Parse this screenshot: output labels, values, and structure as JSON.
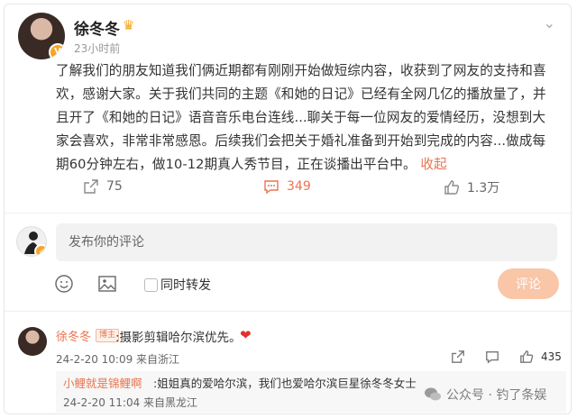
{
  "post": {
    "author": "徐冬冬",
    "time": "23小时前",
    "verified_badge": "V",
    "body": "了解我们的朋友知道我们俩近期都有刚刚开始做短综内容，收获到了网友的支持和喜欢，感谢大家。关于我们共同的主题《和她的日记》已经有全网几亿的播放量了，并且开了《和她的日记》语音音乐电台连线...聊关于每一位网友的爱情经历，没想到大家会喜欢，非常非常感恩。后续我们会把关于婚礼准备到开始到完成的内容...做成每期60分钟左右，做10-12期真人秀节目，正在谈播出平台中。",
    "collapse_label": "收起",
    "share_count": "75",
    "comment_count": "349",
    "like_count": "1.3万"
  },
  "composer": {
    "placeholder": "发布你的评论",
    "repost_label": "同时转发",
    "submit_label": "评论"
  },
  "comment": {
    "author": "徐冬冬",
    "tag": "博主",
    "text": ":摄影剪辑哈尔滨优先。",
    "meta": "24-2-20 10:09 来自浙江",
    "like_count": "435"
  },
  "reply": {
    "author": "小鲤就是锦鲤啊",
    "text": ":姐姐真的爱哈尔滨，我们也爱哈尔滨巨星徐冬冬女士",
    "meta": "24-2-20 11:04 来自黑龙江"
  },
  "watermark": "公众号 · 钓了条娱",
  "colors": {
    "accent": "#eb7350",
    "submit_bg": "#f9c6a8",
    "heart": "#e0332b"
  }
}
